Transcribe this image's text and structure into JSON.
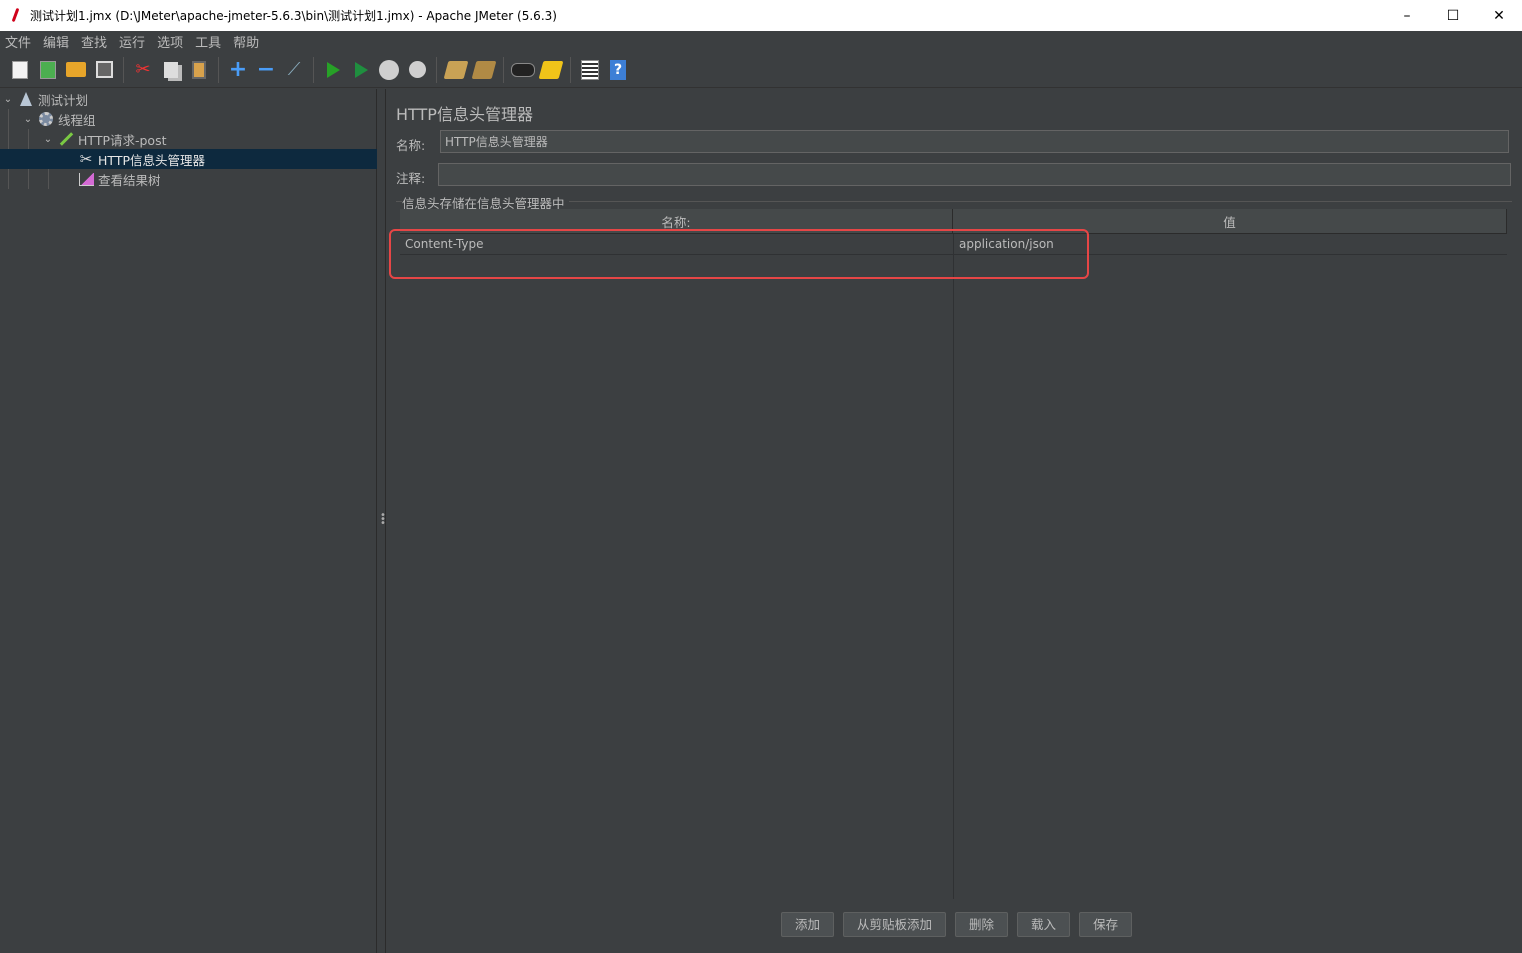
{
  "window": {
    "title": "测试计划1.jmx (D:\\JMeter\\apache-jmeter-5.6.3\\bin\\测试计划1.jmx) - Apache JMeter (5.6.3)",
    "controls": {
      "minimize": "–",
      "maximize": "☐",
      "close": "✕"
    }
  },
  "menu": [
    "文件",
    "编辑",
    "查找",
    "运行",
    "选项",
    "工具",
    "帮助"
  ],
  "toolbar": {
    "icons": [
      "new-icon",
      "templates-icon",
      "open-icon",
      "save-icon",
      "cut-icon",
      "copy-icon",
      "paste-icon",
      "expand-icon",
      "collapse-icon",
      "toggle-icon",
      "start-icon",
      "start-no-pause-icon",
      "stop-icon",
      "shutdown-icon",
      "clear-icon",
      "clear-all-icon",
      "search-icon",
      "reset-search-icon",
      "function-helper-icon",
      "help-icon"
    ],
    "plus": "+",
    "minus": "−",
    "help": "?"
  },
  "tree": {
    "items": [
      {
        "label": "测试计划",
        "icon": "test-plan-icon",
        "expanded": true
      },
      {
        "label": "线程组",
        "icon": "thread-group-icon",
        "expanded": true
      },
      {
        "label": "HTTP请求-post",
        "icon": "http-sampler-icon",
        "expanded": true
      },
      {
        "label": "HTTP信息头管理器",
        "icon": "header-manager-icon",
        "selected": true
      },
      {
        "label": "查看结果树",
        "icon": "results-tree-icon"
      }
    ],
    "chevron": "⌄",
    "tools_glyph": "✂"
  },
  "panel": {
    "title": "HTTP信息头管理器",
    "name_label": "名称:",
    "name_value": "HTTP信息头管理器",
    "comment_label": "注释:",
    "comment_value": "",
    "group_title": "信息头存储在信息头管理器中",
    "table": {
      "headers": [
        "名称:",
        "值"
      ],
      "rows": [
        {
          "name": "Content-Type",
          "value": "application/json"
        }
      ]
    },
    "buttons": [
      "添加",
      "从剪贴板添加",
      "删除",
      "载入",
      "保存"
    ],
    "highlight_color": "#e64646"
  }
}
